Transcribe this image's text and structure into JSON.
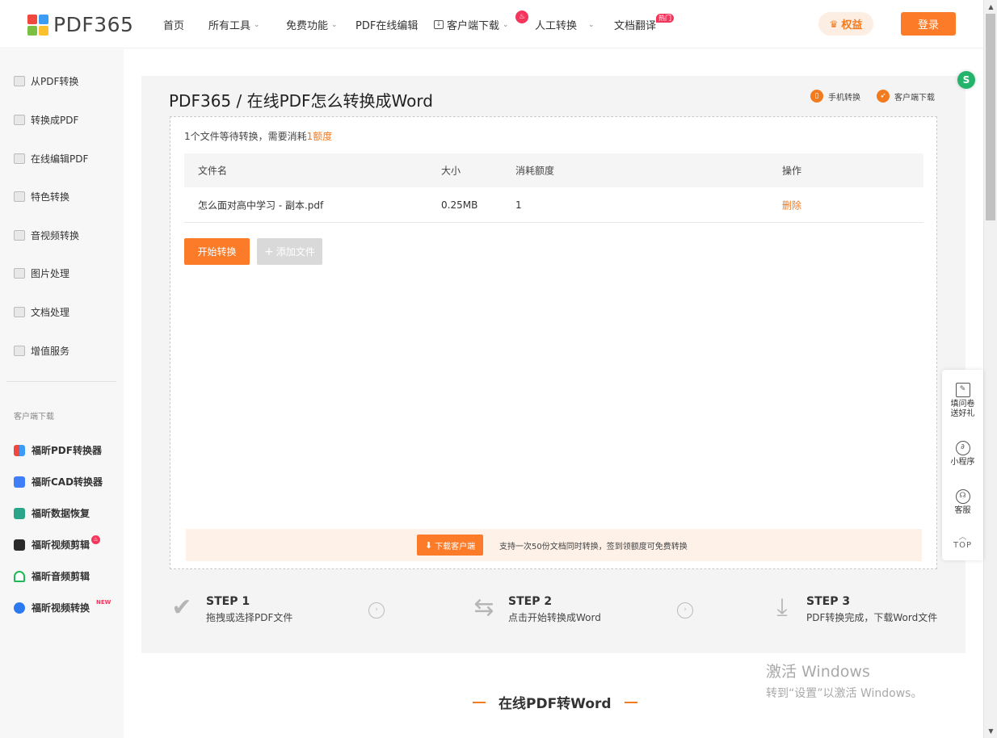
{
  "header": {
    "logo_text": "PDF365",
    "nav": [
      {
        "label": "首页"
      },
      {
        "label": "所有工具"
      },
      {
        "label": "免费功能"
      },
      {
        "label": "PDF在线编辑"
      },
      {
        "label": "客户端下载"
      },
      {
        "label": "人工转换"
      },
      {
        "label": "文档翻译",
        "badge": "热门"
      }
    ],
    "vip_label": "权益",
    "login_label": "登录",
    "brand_color": "#fb7b28"
  },
  "sidebar": {
    "items": [
      {
        "label": "从PDF转换"
      },
      {
        "label": "转换成PDF"
      },
      {
        "label": "在线编辑PDF"
      },
      {
        "label": "特色转换"
      },
      {
        "label": "音视频转换"
      },
      {
        "label": "图片处理"
      },
      {
        "label": "文档处理"
      },
      {
        "label": "增值服务"
      }
    ],
    "download_section_label": "客户端下载",
    "downloads": [
      {
        "label": "福昕PDF转换器",
        "color": "#4c7cf3"
      },
      {
        "label": "福昕CAD转换器",
        "color": "#3f7ef7"
      },
      {
        "label": "福昕数据恢复",
        "color": "#2ba58a"
      },
      {
        "label": "福昕视频剪辑",
        "color": "#2a2a2a"
      },
      {
        "label": "福昕音频剪辑",
        "color": "#1db954"
      },
      {
        "label": "福昕视频转换",
        "color": "#2d79f0",
        "tag": "NEW"
      }
    ]
  },
  "main": {
    "title": "PDF365 / 在线PDF怎么转换成Word",
    "link_mobile": "手机转换",
    "link_client": "客户端下载",
    "info_prefix": "1个文件等待转换，需要消耗",
    "info_highlight": "1额度",
    "table": {
      "headers": [
        "文件名",
        "大小",
        "消耗额度",
        "操作"
      ],
      "rows": [
        {
          "name": "怎么面对高中学习 - 副本.pdf",
          "size": "0.25MB",
          "cost": "1",
          "action": "删除"
        }
      ]
    },
    "start_label": "开始转换",
    "add_label": "添加文件",
    "promo_button": "下载客户端",
    "promo_text": "支持一次50份文档同时转换，签到领额度可免费转换"
  },
  "steps": [
    {
      "title": "STEP 1",
      "desc": "拖拽或选择PDF文件",
      "icon": "check-icon"
    },
    {
      "title": "STEP 2",
      "desc": "点击开始转换成Word",
      "icon": "swap-icon"
    },
    {
      "title": "STEP 3",
      "desc": "PDF转换完成，下载Word文件",
      "icon": "download-icon"
    }
  ],
  "float_panel": {
    "survey": "填问卷送好礼",
    "miniprogram": "小程序",
    "service": "客服",
    "top": "TOP"
  },
  "section_title": "在线PDF转Word",
  "watermark": {
    "line1": "激活 Windows",
    "line2": "转到“设置”以激活 Windows。"
  }
}
